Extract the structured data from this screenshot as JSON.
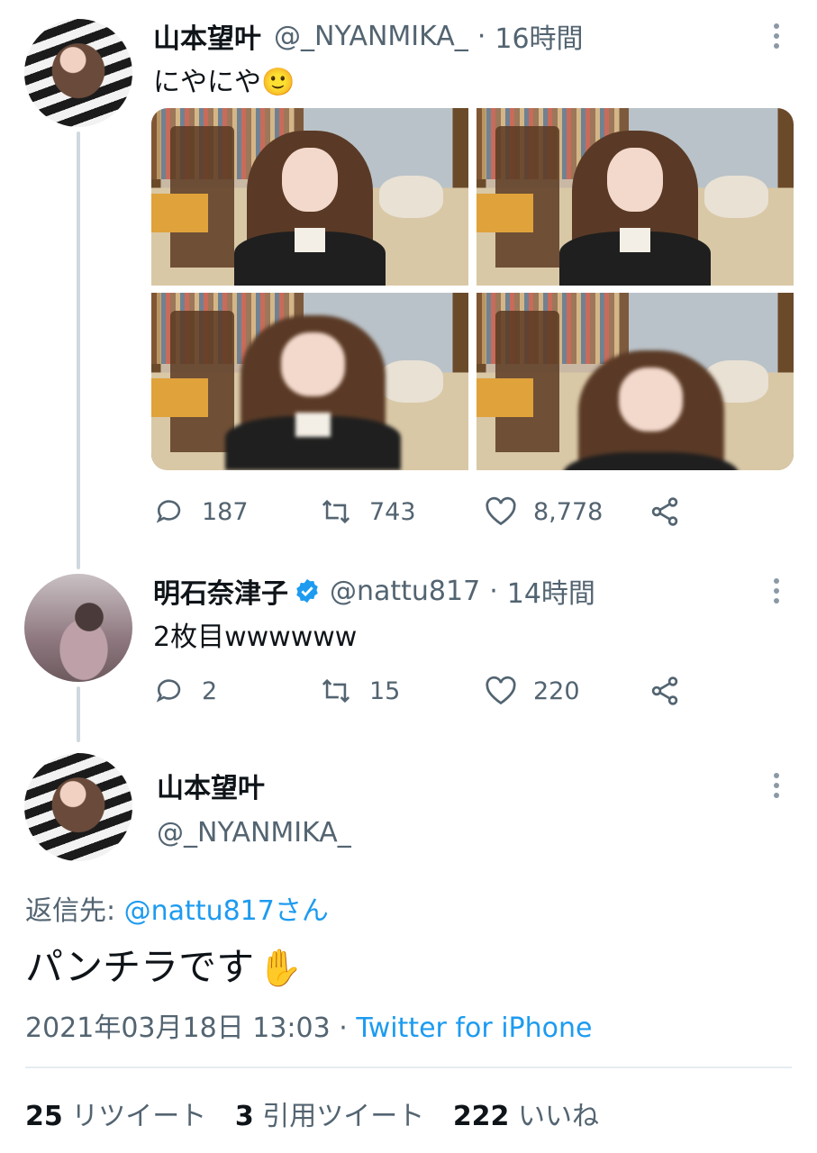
{
  "tweet1": {
    "name": "山本望叶",
    "handle": "@_NYANMIKA_",
    "dot": "·",
    "time": "16時間",
    "text": "にやにや",
    "emoji": "🙂",
    "replies": "187",
    "retweets": "743",
    "likes": "8,778"
  },
  "tweet2": {
    "name": "明石奈津子",
    "handle": "@nattu817",
    "dot": "·",
    "time": "14時間",
    "text": "2枚目wwwwww",
    "replies": "2",
    "retweets": "15",
    "likes": "220"
  },
  "main": {
    "name": "山本望叶",
    "handle": "@_NYANMIKA_",
    "reply_to_label": "返信先:",
    "reply_to_user": "@nattu817さん",
    "text": "パンチラです",
    "emoji": "✋",
    "datetime": "2021年03月18日 13:03",
    "dot": "·",
    "source": "Twitter for iPhone",
    "retweet_count": "25",
    "retweet_label": "リツイート",
    "quote_count": "3",
    "quote_label": "引用ツイート",
    "like_count": "222",
    "like_label": "いいね"
  },
  "colors": {
    "link": "#1d9bf0",
    "secondary_text": "#536471",
    "verified": "#1d9bf0"
  }
}
